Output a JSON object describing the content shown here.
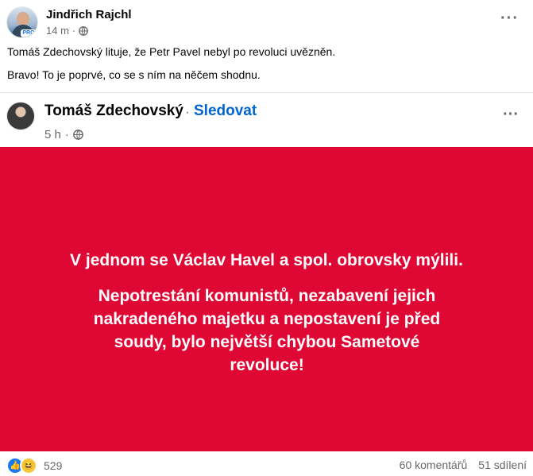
{
  "post": {
    "author": "Jindřich Rajchl",
    "time": "14 m",
    "badge": "PRO",
    "line1": "Tomáš Zdechovský lituje, že Petr Pavel nebyl po revoluci uvězněn.",
    "line2": "Bravo! To je poprvé, co se s ním na něčem shodnu."
  },
  "shared": {
    "author": "Tomáš Zdechovský",
    "separator": "·",
    "follow": "Sledovat",
    "time": "5 h",
    "headline": "V jednom se Václav Havel a spol. obrovsky mýlili.",
    "body": "Nepotrestání komunistů, nezabavení jejich nakradeného majetku a nepostavení je před soudy, bylo největší chybou Sametové revoluce!",
    "background_color": "#df0734"
  },
  "footer": {
    "reaction_count": "529",
    "comments": "60 komentářů",
    "shares": "51 sdílení"
  },
  "icons": [
    "globe-icon",
    "more-icon",
    "like-reaction-icon",
    "haha-reaction-icon"
  ]
}
